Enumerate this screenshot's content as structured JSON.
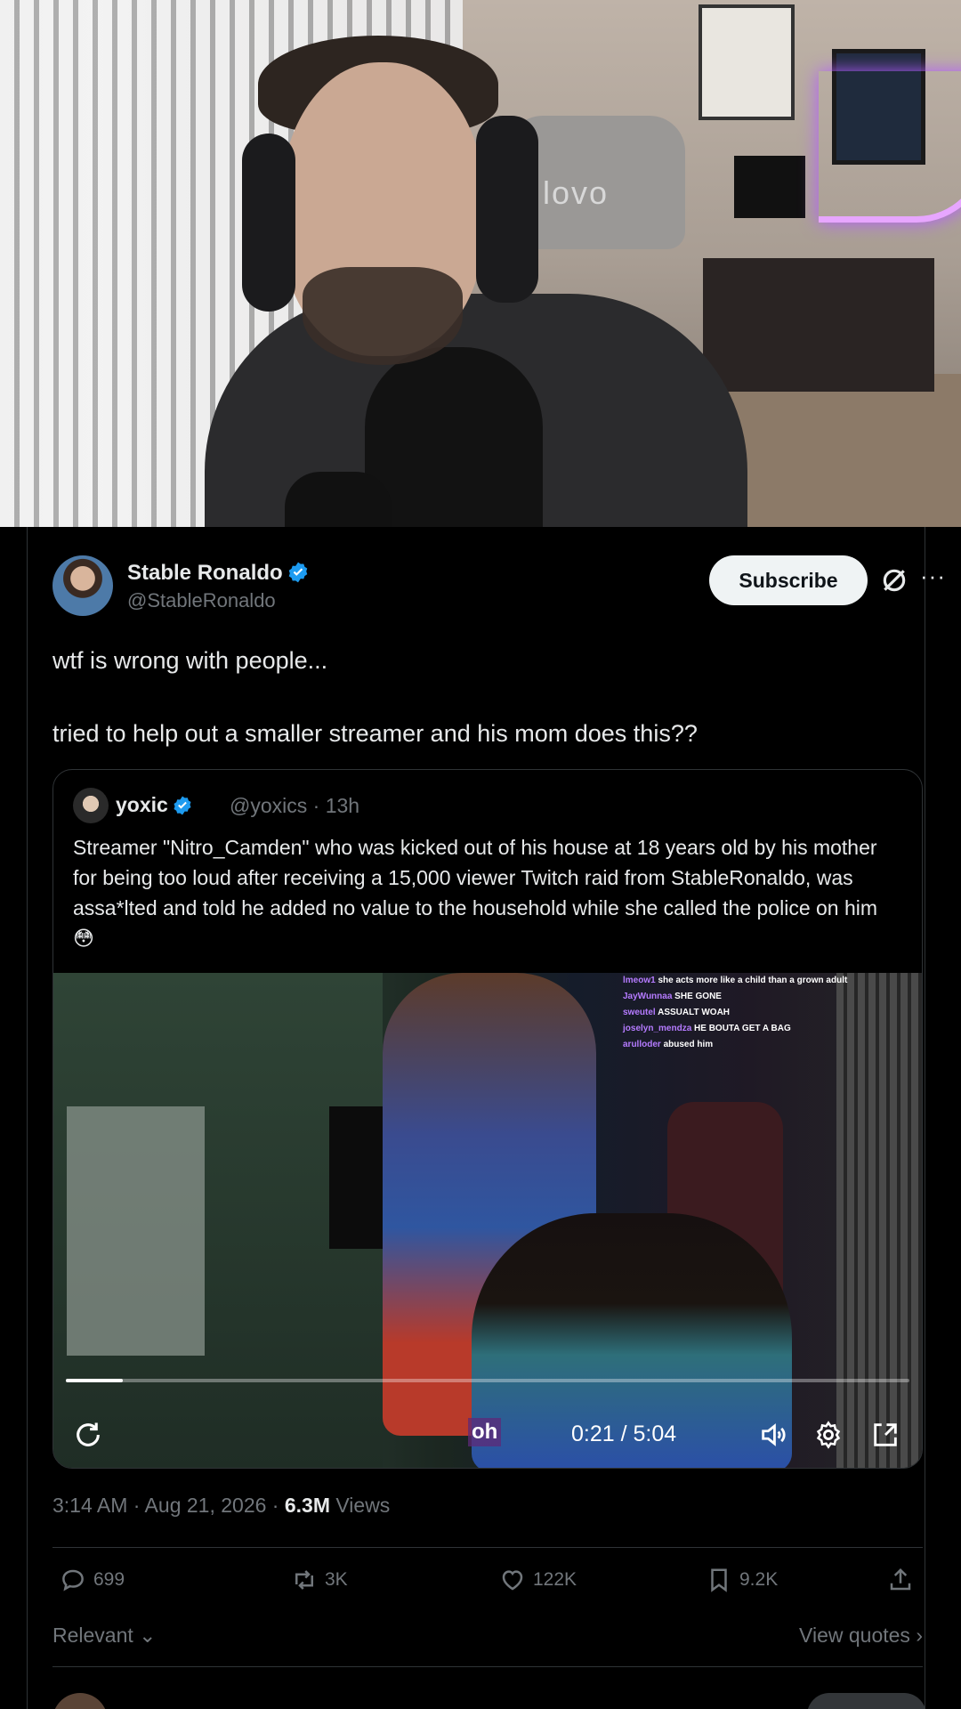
{
  "webcam": {
    "chair_brand": "lovo"
  },
  "tweet": {
    "author_name": "Stable Ronaldo",
    "author_handle": "@StableRonaldo",
    "subscribe_label": "Subscribe",
    "more_label": "···",
    "text_line1": "wtf is wrong with people...",
    "text_line2": "tried to help out a smaller streamer and his mom does this??",
    "timestamp": "3:14 AM · Aug 21, 2026 · ",
    "views_count": "6.3M",
    "views_label": " Views",
    "replies": "699",
    "reposts": "3K",
    "likes": "122K",
    "bookmarks": "9.2K",
    "sort_label": "Relevant",
    "view_quotes_label": "View quotes"
  },
  "quote": {
    "author_name": "yoxic",
    "author_handle": "@yoxics · 13h",
    "text": "Streamer \"Nitro_Camden\" who was kicked out of his house at 18 years old by his mother for being too loud after receiving a 15,000 viewer Twitch raid from StableRonaldo, was assa*lted and told he added no value to the household while she called the police on him 😳"
  },
  "video": {
    "chat": [
      {
        "user": "lmeow1",
        "msg": "she acts more like a child than a grown adult"
      },
      {
        "user": "JayWunnaa",
        "msg": "SHE GONE"
      },
      {
        "user": "sweutel",
        "msg": "ASSUALT WOAH"
      },
      {
        "user": "joselyn_mendza",
        "msg": "HE BOUTA GET A BAG"
      },
      {
        "user": "arulloder",
        "msg": "abused him"
      }
    ],
    "caption": "oh",
    "time": "0:21 / 5:04",
    "progress": 0.067
  },
  "colors": {
    "background": "#000000",
    "text": "#e7e9ea",
    "muted": "#71767b",
    "border": "#2f3336",
    "verified": "#1d9bf0"
  }
}
